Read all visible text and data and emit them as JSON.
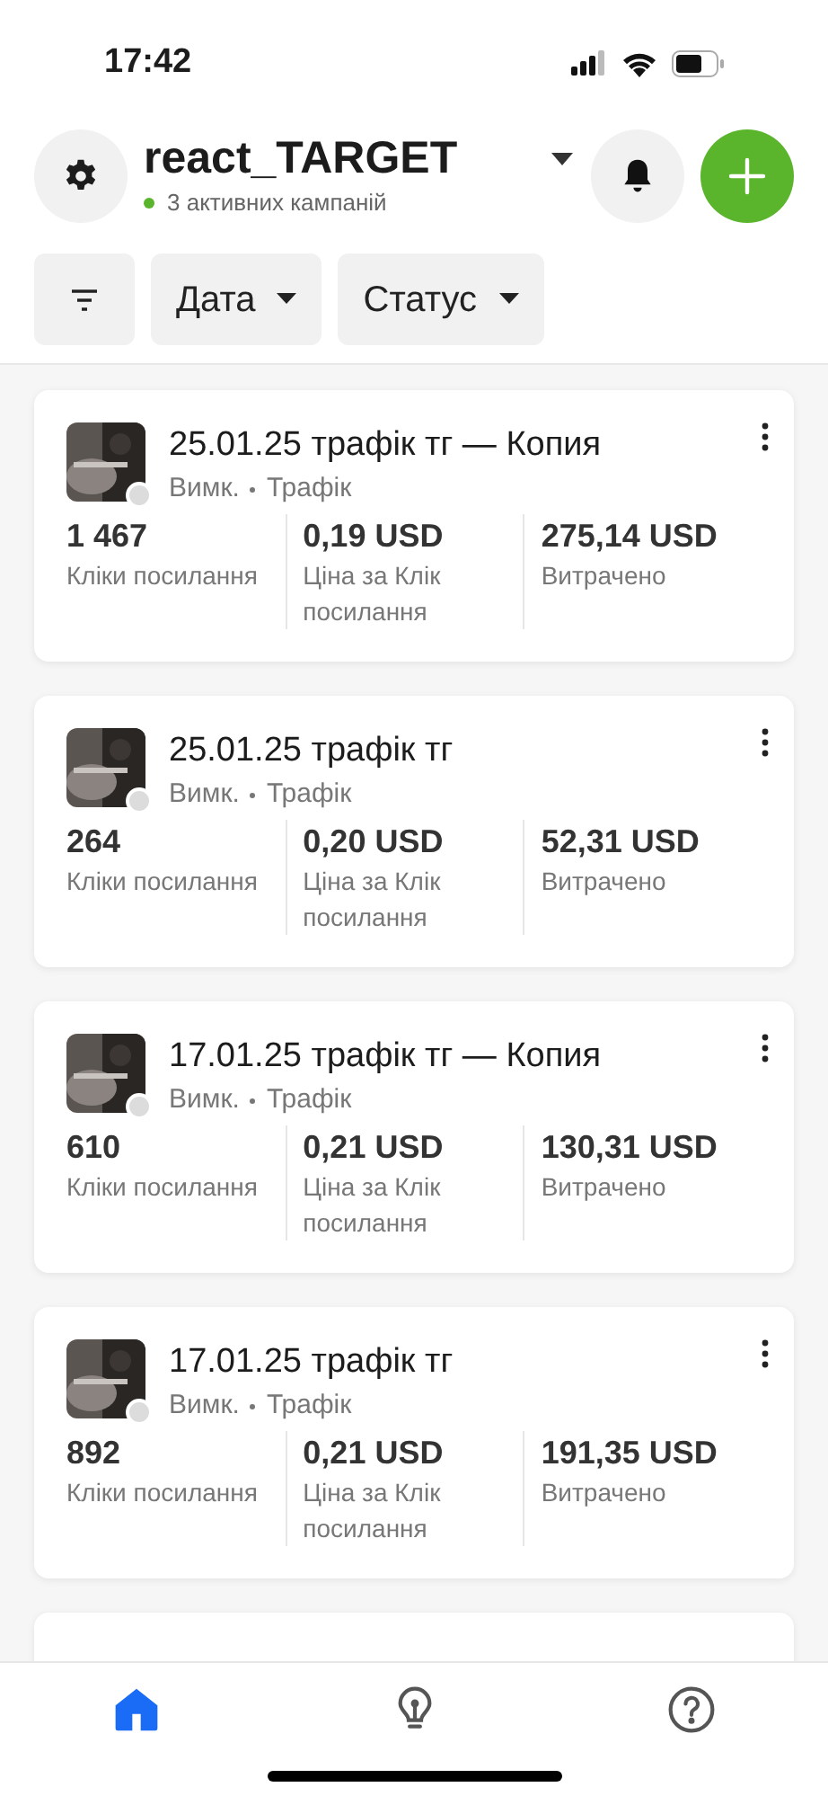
{
  "status_bar": {
    "time": "17:42"
  },
  "header": {
    "account": "react_TARGET",
    "subtitle": "3 активних кампаній"
  },
  "filters": [
    {
      "kind": "icon"
    },
    {
      "kind": "dropdown",
      "label": "Дата"
    },
    {
      "kind": "dropdown",
      "label": "Статус"
    }
  ],
  "campaigns": [
    {
      "title": "25.01.25 трафік тг — Копия",
      "status": "Вимк.",
      "objective": "Трафік",
      "metrics": [
        {
          "value": "1 467",
          "label": "Кліки посилання"
        },
        {
          "value": "0,19 USD",
          "label": "Ціна за Клік посилання"
        },
        {
          "value": "275,14 USD",
          "label": "Витрачено"
        }
      ]
    },
    {
      "title": "25.01.25 трафік тг",
      "status": "Вимк.",
      "objective": "Трафік",
      "metrics": [
        {
          "value": "264",
          "label": "Кліки посилання"
        },
        {
          "value": "0,20 USD",
          "label": "Ціна за Клік посилання"
        },
        {
          "value": "52,31 USD",
          "label": "Витрачено"
        }
      ]
    },
    {
      "title": "17.01.25 трафік тг — Копия",
      "status": "Вимк.",
      "objective": "Трафік",
      "metrics": [
        {
          "value": "610",
          "label": "Кліки посилання"
        },
        {
          "value": "0,21 USD",
          "label": "Ціна за Клік посилання"
        },
        {
          "value": "130,31 USD",
          "label": "Витрачено"
        }
      ]
    },
    {
      "title": "17.01.25 трафік тг",
      "status": "Вимк.",
      "objective": "Трафік",
      "metrics": [
        {
          "value": "892",
          "label": "Кліки посилання"
        },
        {
          "value": "0,21 USD",
          "label": "Ціна за Клік посилання"
        },
        {
          "value": "191,35 USD",
          "label": "Витрачено"
        }
      ]
    }
  ],
  "nav": [
    {
      "kind": "home",
      "selected": true
    },
    {
      "kind": "ideas",
      "selected": false
    },
    {
      "kind": "help",
      "selected": false
    }
  ]
}
